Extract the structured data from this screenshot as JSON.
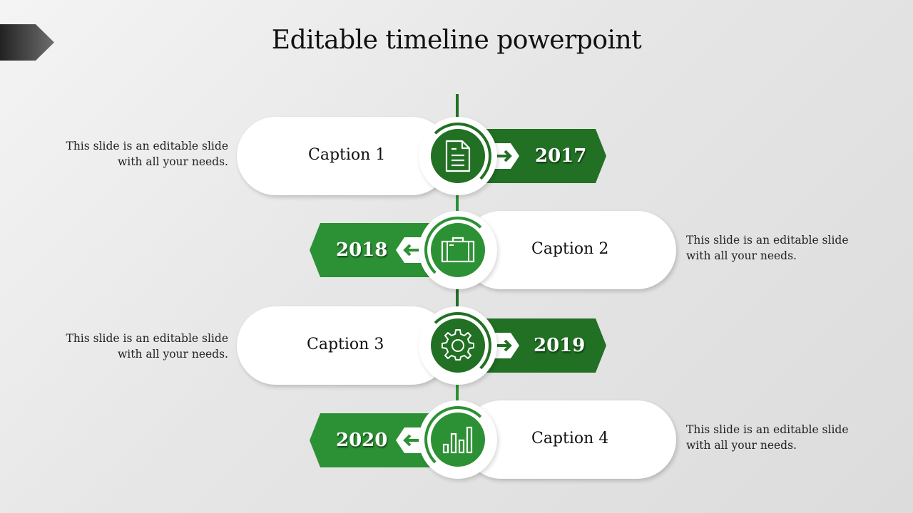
{
  "title": "Editable timeline powerpoint",
  "colors": {
    "dark_green": "#217024",
    "light_green": "#2c9134",
    "white": "#ffffff",
    "text": "#111111"
  },
  "steps": [
    {
      "caption": "Caption 1",
      "year": "2017",
      "icon": "document-icon",
      "side": "right",
      "description": [
        "This slide is an editable slide",
        "with all your needs."
      ]
    },
    {
      "caption": "Caption 2",
      "year": "2018",
      "icon": "briefcase-icon",
      "side": "left",
      "description": [
        "This slide is an editable slide",
        "with all your needs."
      ]
    },
    {
      "caption": "Caption 3",
      "year": "2019",
      "icon": "gear-icon",
      "side": "right",
      "description": [
        "This slide is an editable slide",
        "with all your needs."
      ]
    },
    {
      "caption": "Caption 4",
      "year": "2020",
      "icon": "bar-chart-icon",
      "side": "left",
      "description": [
        "This slide is an editable slide",
        "with all your needs."
      ]
    }
  ]
}
